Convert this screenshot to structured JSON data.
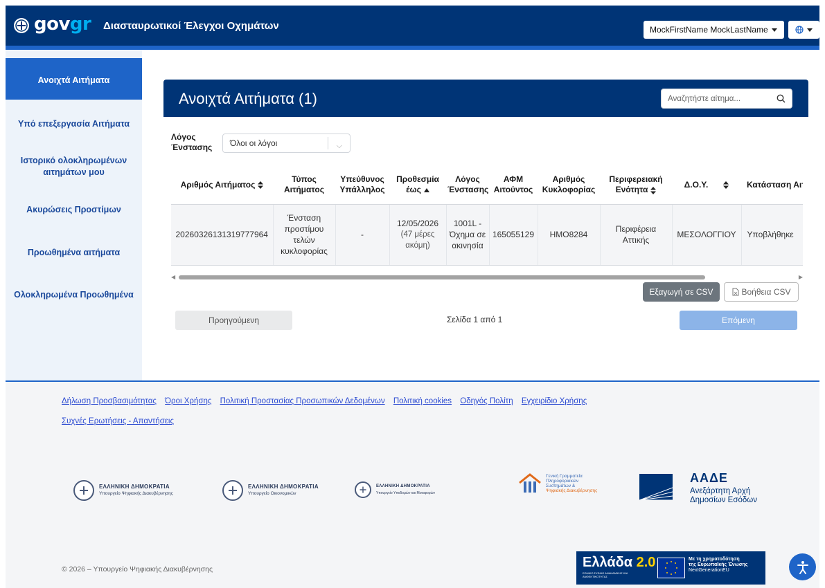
{
  "header": {
    "logo_gov": "gov",
    "logo_gr": "gr",
    "app_title": "Διασταυρωτικοί Έλεγχοι Οχημάτων",
    "user_name": "MockFirstName MockLastName",
    "lang_icon": "globe-icon"
  },
  "sidebar": {
    "items": [
      {
        "label": "Ανοιχτά Αιτήματα",
        "active": true
      },
      {
        "label": "Υπό επεξεργασία Αιτήματα"
      },
      {
        "label": "Ιστορικό ολοκληρωμένων αιτημάτων μου"
      },
      {
        "label": "Ακυρώσεις Προστίμων"
      },
      {
        "label": "Προωθημένα αιτήματα"
      },
      {
        "label": "Ολοκληρωμένα Προωθημένα"
      }
    ]
  },
  "main": {
    "title": "Ανοιχτά Αιτήματα (1)",
    "search_placeholder": "Αναζητήστε αίτημα...",
    "filter_label": "Λόγος Ένστασης",
    "filter_value": "Όλοι οι λόγοι",
    "columns": [
      "Αριθμός Αιτήματος",
      "Τύπος Αιτήματος",
      "Υπεύθυνος Υπάλληλος",
      "Προθεσμία έως",
      "Λόγος Ένστασης",
      "ΑΦΜ Αιτούντος",
      "Αριθμός Κυκλοφορίας",
      "Περιφερειακή Ενότητα",
      "Δ.Ο.Υ.",
      "Κατάσταση Αιτήματος"
    ],
    "rows": [
      {
        "request_no": "20260326131319777964",
        "type": "Ένσταση προστίμου τελών κυκλοφορίας",
        "employee": "-",
        "deadline": "12/05/2026",
        "deadline_note": "(47 μέρες ακόμη)",
        "reason": "1001L - Όχημα σε ακινησία",
        "afm": "165055129",
        "plate": "HMO8284",
        "region": "Περιφέρεια Αττικής",
        "doy": "ΜΕΣΟΛΟΓΓΙΟΥ",
        "status": "Υποβλήθηκε"
      }
    ],
    "export_csv": "Εξαγωγή σε CSV",
    "help_csv": "Βοήθεια CSV",
    "prev": "Προηγούμενη",
    "page_info": "Σελίδα 1 από 1",
    "next": "Επόμενη"
  },
  "footer": {
    "links": [
      "Δήλωση Προσβασιμότητας",
      "Όροι Χρήσης",
      "Πολιτική Προστασίας Προσωπικών Δεδομένων",
      "Πολιτική cookies",
      "Οδηγός Πολίτη",
      "Εγχειρίδιο Χρήσης",
      "Συχνές Ερωτήσεις - Απαντήσεις"
    ],
    "logos": [
      {
        "l1": "ΕΛΛΗΝΙΚΗ ΔΗΜΟΚΡΑΤΙΑ",
        "l2": "Υπουργείο Ψηφιακής Διακυβέρνησης"
      },
      {
        "l1": "ΕΛΛΗΝΙΚΗ ΔΗΜΟΚΡΑΤΙΑ",
        "l2": "Υπουργείο Οικονομικών"
      },
      {
        "l1": "ΕΛΛΗΝΙΚΗ ΔΗΜΟΚΡΑΤΙΑ",
        "l2": "Υπουργείο Υποδομών και Μεταφορών"
      }
    ],
    "gsis_lines": [
      "Γενική Γραμματεία",
      "Πληροφοριακών",
      "Συστημάτων &",
      "Ψηφιακής Διακυβέρνησης"
    ],
    "aade_title": "ΑΑΔΕ",
    "aade_sub1": "Ανεξάρτητη Αρχή",
    "aade_sub2": "Δημοσίων Εσόδων",
    "copyright": "© 2026 – Υπουργείο Ψηφιακής Διακυβέρνησης",
    "ellada_main": "Ελλάδα",
    "ellada_ver": "2.0",
    "ellada_sub": "ΕΘΝΙΚΟ ΣΧΕΔΙΟ ΑΝΑΚΑΜΨΗΣ ΚΑΙ ΑΝΘΕΚΤΙΚΟΤΗΤΑΣ",
    "eu_line1": "Με τη χρηματοδότηση",
    "eu_line2": "της Ευρωπαϊκής Ένωσης",
    "eu_line3": "NextGenerationEU"
  }
}
